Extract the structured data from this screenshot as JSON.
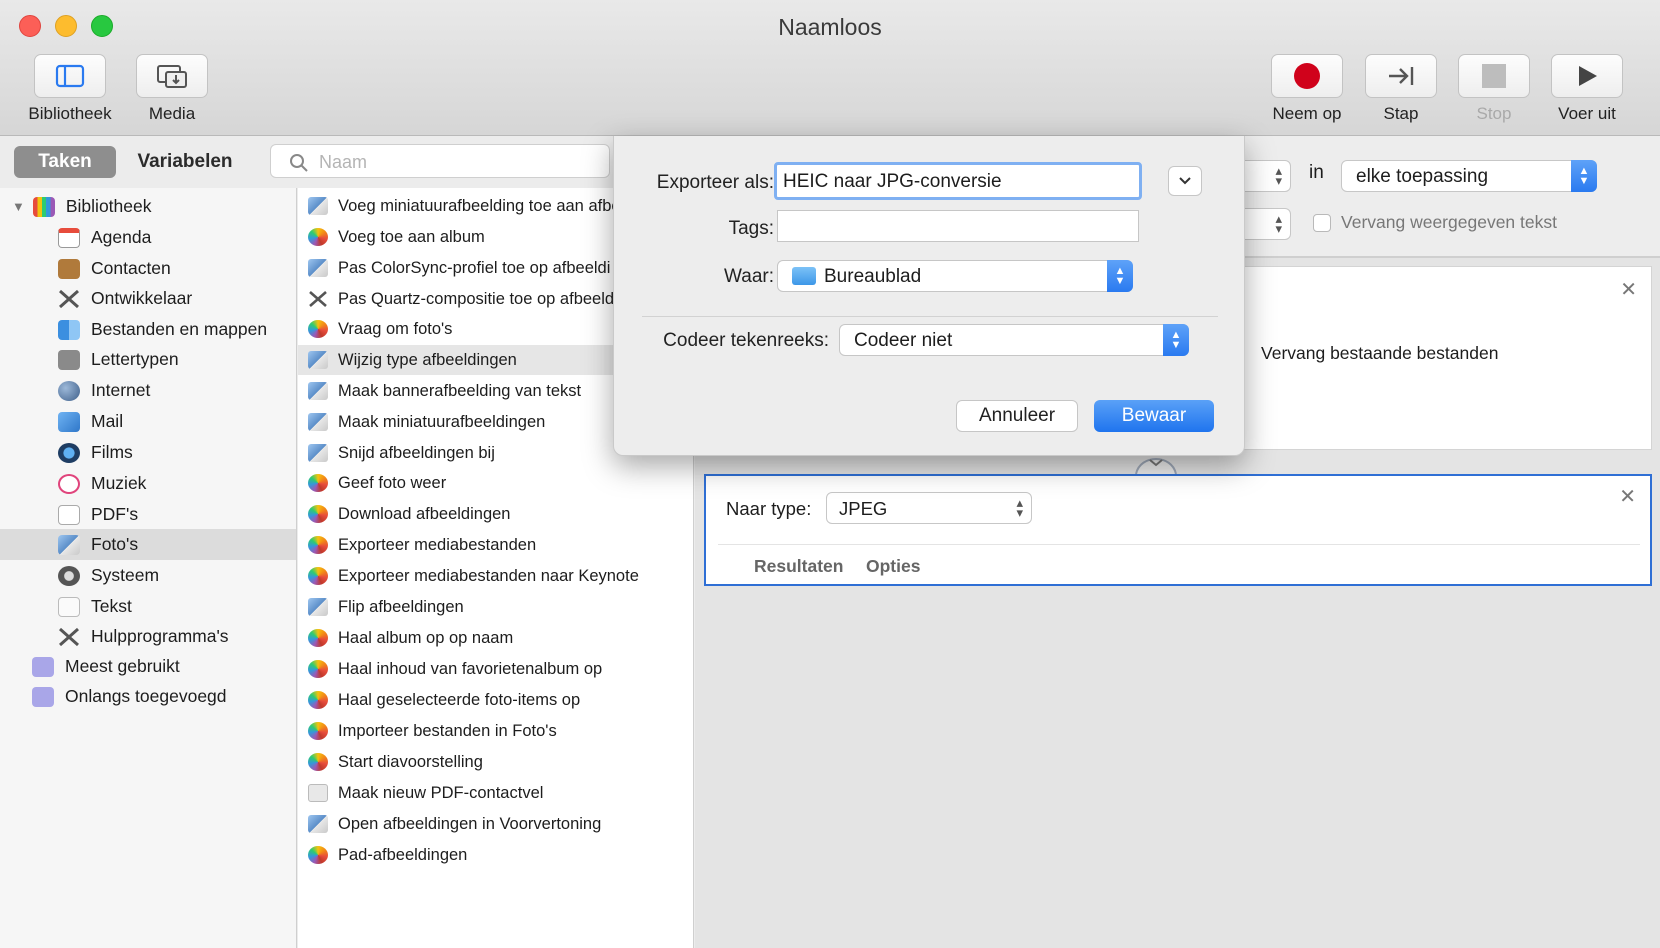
{
  "window": {
    "title": "Naamloos"
  },
  "toolbar": {
    "library_label": "Bibliotheek",
    "media_label": "Media",
    "record_label": "Neem op",
    "step_label": "Stap",
    "stop_label": "Stop",
    "run_label": "Voer uit"
  },
  "left_header": {
    "tab_actions": "Taken",
    "tab_variables": "Variabelen",
    "search_placeholder": "Naam"
  },
  "sidebar": {
    "items": [
      {
        "label": "Bibliotheek",
        "icon": "library-icon"
      },
      {
        "label": "Agenda",
        "icon": "calendar-icon"
      },
      {
        "label": "Contacten",
        "icon": "contacts-icon"
      },
      {
        "label": "Ontwikkelaar",
        "icon": "developer-tools-icon"
      },
      {
        "label": "Bestanden en mappen",
        "icon": "finder-icon"
      },
      {
        "label": "Lettertypen",
        "icon": "fonts-icon"
      },
      {
        "label": "Internet",
        "icon": "globe-icon"
      },
      {
        "label": "Mail",
        "icon": "mail-icon"
      },
      {
        "label": "Films",
        "icon": "quicktime-icon"
      },
      {
        "label": "Muziek",
        "icon": "music-icon"
      },
      {
        "label": "PDF's",
        "icon": "pdf-icon"
      },
      {
        "label": "Foto's",
        "icon": "photos-icon"
      },
      {
        "label": "Systeem",
        "icon": "system-icon"
      },
      {
        "label": "Tekst",
        "icon": "text-icon"
      },
      {
        "label": "Hulpprogramma's",
        "icon": "utilities-icon"
      },
      {
        "label": "Meest gebruikt",
        "icon": "smart-folder-icon"
      },
      {
        "label": "Onlangs toegevoegd",
        "icon": "smart-folder-icon"
      }
    ]
  },
  "actions": {
    "items": [
      "Voeg miniatuurafbeelding toe aan afbee",
      "Voeg toe aan album",
      "Pas ColorSync-profiel toe op afbeeldi",
      "Pas Quartz-compositie toe op afbeeld",
      "Vraag om foto's",
      "Wijzig type afbeeldingen",
      "Maak bannerafbeelding van tekst",
      "Maak miniatuurafbeeldingen",
      "Snijd afbeeldingen bij",
      "Geef foto weer",
      "Download afbeeldingen",
      "Exporteer mediabestanden",
      "Exporteer mediabestanden naar Keynote",
      "Flip afbeeldingen",
      "Haal album op op naam",
      "Haal inhoud van favorietenalbum op",
      "Haal geselecteerde foto-items op",
      "Importeer bestanden in Foto's",
      "Start diavoorstelling",
      "Maak nieuw PDF-contactvel",
      "Open afbeeldingen in Voorvertoning",
      "Pad-afbeeldingen"
    ]
  },
  "workflow": {
    "in_label": "in",
    "app_select": "elke toepassing",
    "replace_text_label": "Vervang weergegeven tekst",
    "replace_files_label": "Vervang bestaande bestanden",
    "to_type_label": "Naar type:",
    "to_type_value": "JPEG",
    "tab_results": "Resultaten",
    "tab_options": "Opties"
  },
  "dialog": {
    "export_as_label": "Exporteer als:",
    "export_as_value": "HEIC naar JPG-conversie",
    "tags_label": "Tags:",
    "tags_value": "",
    "where_label": "Waar:",
    "where_value": "Bureaublad",
    "encoding_label": "Codeer tekenreeks:",
    "encoding_value": "Codeer niet",
    "cancel_label": "Annuleer",
    "save_label": "Bewaar"
  },
  "colors": {
    "accent": "#2a7af0",
    "record": "#d0021b",
    "selection_blue": "#2f6fd5"
  }
}
